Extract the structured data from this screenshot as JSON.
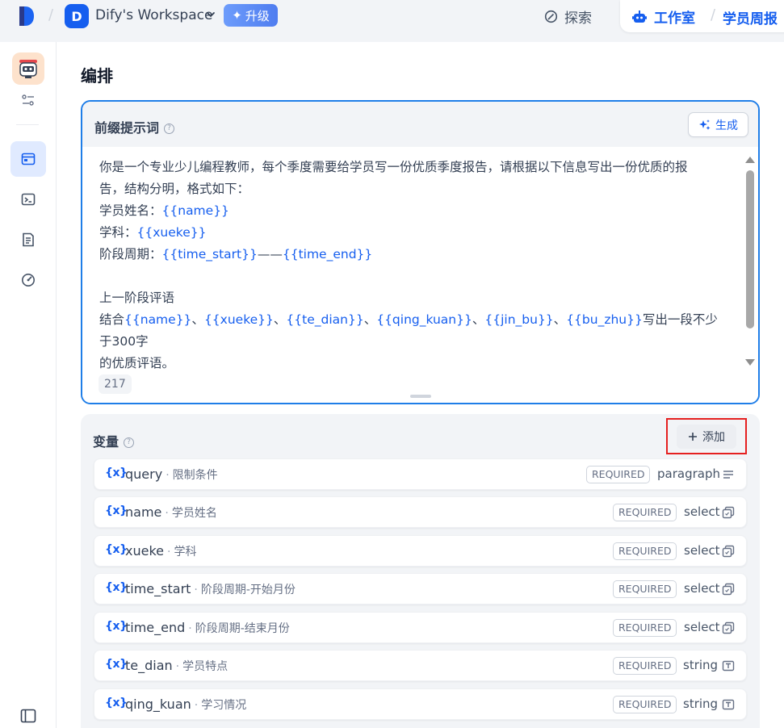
{
  "topbar": {
    "workspace_initial": "D",
    "workspace_name": "Dify's Workspace",
    "upgrade_label": "升级",
    "explore_label": "探索",
    "studio_label": "工作室",
    "app_name": "学员周报"
  },
  "sidebar": {
    "items": [
      {
        "icon": "orchestrate-icon",
        "active": true
      },
      {
        "icon": "terminal-icon",
        "active": false
      },
      {
        "icon": "logs-icon",
        "active": false
      },
      {
        "icon": "monitoring-icon",
        "active": false
      }
    ]
  },
  "page": {
    "title": "编排"
  },
  "prompt": {
    "title": "前缀提示词",
    "help_glyph": "?",
    "generate_label": "生成",
    "char_count": "217",
    "text": {
      "line1": "你是一个专业少儿编程教师，每个季度需要给学员写一份优质季度报告，请根据以下信息写出一份优质的报",
      "line2": "告，结构分明，格式如下：",
      "name_label": "学员姓名：",
      "name_var": "{{name}}",
      "subject_label": "学科：",
      "subject_var": "{{xueke}}",
      "period_label": "阶段周期：",
      "period_start_var": "{{time_start}}",
      "period_dash": "——",
      "period_end_var": "{{time_end}}",
      "prev_comment": "上一阶段评语",
      "combine_label": "结合",
      "combine_vars": [
        "{{name}}",
        "{{xueke}}",
        "{{te_dian}}",
        "{{qing_kuan}}",
        "{{jin_bu}}",
        "{{bu_zhu}}"
      ],
      "separator": "、",
      "combine_tail": "写出一段不少于300字",
      "last_line": "的优质评语。"
    }
  },
  "variables": {
    "title": "变量",
    "add_label": "添加",
    "required_label": "REQUIRED",
    "rows": [
      {
        "key": "query",
        "desc": "限制条件",
        "type": "paragraph"
      },
      {
        "key": "name",
        "desc": "学员姓名",
        "type": "select"
      },
      {
        "key": "xueke",
        "desc": "学科",
        "type": "select"
      },
      {
        "key": "time_start",
        "desc": "阶段周期-开始月份",
        "type": "select"
      },
      {
        "key": "time_end",
        "desc": "阶段周期-结束月份",
        "type": "select"
      },
      {
        "key": "te_dian",
        "desc": "学员特点",
        "type": "string"
      },
      {
        "key": "qing_kuan",
        "desc": "学习情况",
        "type": "string"
      }
    ],
    "var_icon_glyph": "{x}",
    "dot": "·"
  },
  "colors": {
    "accent": "#155eef",
    "highlight_border": "#e52020",
    "prompt_border": "#1f7ee8"
  }
}
